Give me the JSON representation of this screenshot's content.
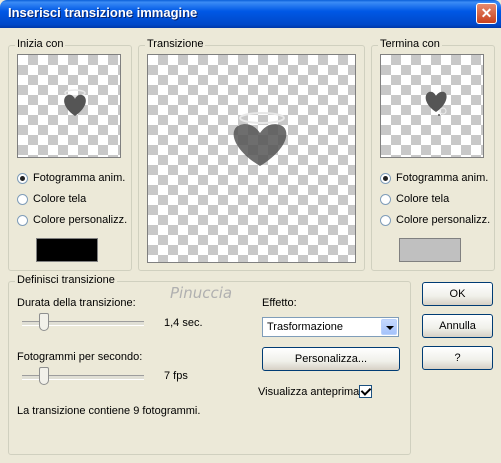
{
  "window": {
    "title": "Inserisci transizione immagine",
    "close_glyph": "✕"
  },
  "start_group": {
    "legend": "Inizia con",
    "options": [
      "Fotogramma anim.",
      "Colore tela",
      "Colore personalizz."
    ],
    "selected_index": 0,
    "custom_color": "#000000"
  },
  "transition_group": {
    "legend": "Transizione"
  },
  "end_group": {
    "legend": "Termina con",
    "options": [
      "Fotogramma anim.",
      "Colore tela",
      "Colore personalizz."
    ],
    "selected_index": 0,
    "custom_color": "#c0c0c0"
  },
  "define_group": {
    "legend": "Definisci transizione",
    "duration_label": "Durata della transizione:",
    "duration_value": "1,4 sec.",
    "duration_level": 0.15,
    "fps_label": "Fotogrammi per secondo:",
    "fps_value": "7 fps",
    "fps_level": 0.15,
    "info_text": "La transizione contiene 9 fotogrammi.",
    "effect_label": "Effetto:",
    "effect_value": "Trasformazione",
    "customize_button": "Personalizza...",
    "preview_label": "Visualizza anteprima",
    "preview_checked": true
  },
  "watermark": "Pinuccia",
  "buttons": {
    "ok": "OK",
    "cancel": "Annulla",
    "help": "?"
  }
}
